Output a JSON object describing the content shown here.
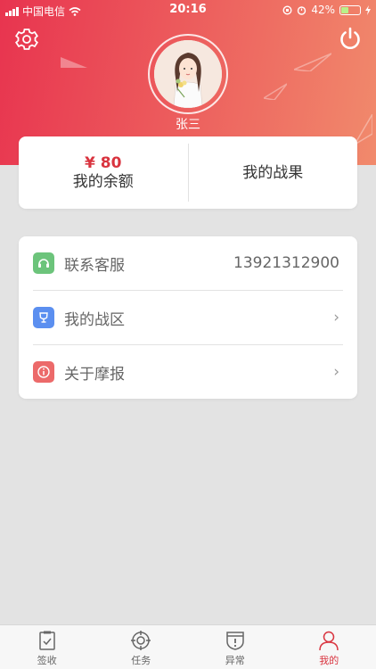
{
  "status_bar": {
    "carrier": "中国电信",
    "time": "20:16",
    "battery_percent": "42%"
  },
  "profile": {
    "name": "张三"
  },
  "balance_card": {
    "amount": "¥ 80",
    "balance_label": "我的余额",
    "results_label": "我的战果"
  },
  "menu": {
    "items": [
      {
        "label": "联系客服",
        "value": "13921312900",
        "icon": "headset-icon",
        "color": "#6cc47b"
      },
      {
        "label": "我的战区",
        "value": "",
        "icon": "trophy-icon",
        "color": "#5b8ff0"
      },
      {
        "label": "关于摩报",
        "value": "",
        "icon": "info-icon",
        "color": "#ec6a6a"
      }
    ],
    "chevron": "›"
  },
  "tabs": [
    {
      "label": "签收",
      "icon": "clipboard-check-icon",
      "active": false
    },
    {
      "label": "任务",
      "icon": "crosshair-icon",
      "active": false
    },
    {
      "label": "异常",
      "icon": "alert-shield-icon",
      "active": false
    },
    {
      "label": "我的",
      "icon": "person-icon",
      "active": true
    }
  ],
  "colors": {
    "accent": "#d9343f",
    "header_start": "#e8344f",
    "header_end": "#f18a6c"
  }
}
